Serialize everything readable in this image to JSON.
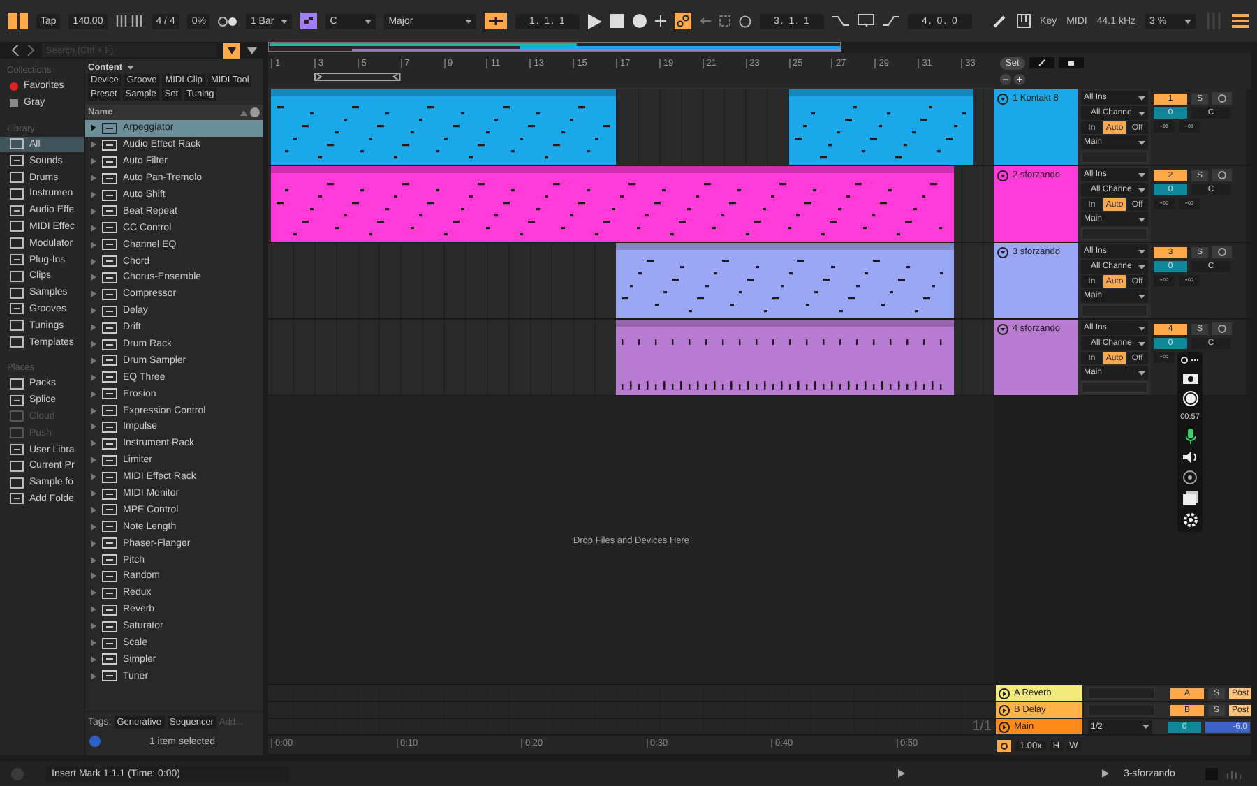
{
  "transport": {
    "tap": "Tap",
    "tempo": "140.00",
    "signature": "4 / 4",
    "swing": "0%",
    "quantize": "1 Bar",
    "key": "C",
    "scale": "Major",
    "position": "1. 1. 1",
    "loop_start": "3. 1. 1",
    "loop_length": "4. 0. 0",
    "key_map": "Key",
    "midi_map": "MIDI",
    "sample_rate": "44.1 kHz",
    "cpu": "3 %"
  },
  "search": {
    "placeholder": "Search (Ctrl + F)"
  },
  "sidebar": {
    "sections": [
      {
        "title": "Collections",
        "items": [
          {
            "label": "Favorites",
            "selected": false,
            "disabled": false,
            "color": "#e02424"
          },
          {
            "label": "Gray",
            "selected": false,
            "disabled": false,
            "color": "#8a8a8a"
          }
        ]
      },
      {
        "title": "Library",
        "items": [
          {
            "label": "All",
            "selected": true,
            "disabled": false
          },
          {
            "label": "Sounds",
            "selected": false,
            "disabled": false
          },
          {
            "label": "Drums",
            "selected": false,
            "disabled": false
          },
          {
            "label": "Instrumen",
            "selected": false,
            "disabled": false
          },
          {
            "label": "Audio Effe",
            "selected": false,
            "disabled": false
          },
          {
            "label": "MIDI Effec",
            "selected": false,
            "disabled": false
          },
          {
            "label": "Modulator",
            "selected": false,
            "disabled": false
          },
          {
            "label": "Plug-Ins",
            "selected": false,
            "disabled": false
          },
          {
            "label": "Clips",
            "selected": false,
            "disabled": false
          },
          {
            "label": "Samples",
            "selected": false,
            "disabled": false
          },
          {
            "label": "Grooves",
            "selected": false,
            "disabled": false
          },
          {
            "label": "Tunings",
            "selected": false,
            "disabled": false
          },
          {
            "label": "Templates",
            "selected": false,
            "disabled": false
          }
        ]
      },
      {
        "title": "Places",
        "items": [
          {
            "label": "Packs",
            "selected": false,
            "disabled": false
          },
          {
            "label": "Splice",
            "selected": false,
            "disabled": false
          },
          {
            "label": "Cloud",
            "selected": false,
            "disabled": true
          },
          {
            "label": "Push",
            "selected": false,
            "disabled": true
          },
          {
            "label": "User Libra",
            "selected": false,
            "disabled": false
          },
          {
            "label": "Current Pr",
            "selected": false,
            "disabled": false
          },
          {
            "label": "Sample fo",
            "selected": false,
            "disabled": false
          },
          {
            "label": "Add Folde",
            "selected": false,
            "disabled": false
          }
        ]
      }
    ]
  },
  "browser": {
    "content_label": "Content",
    "filters": [
      "Device",
      "Groove",
      "MIDI Clip",
      "MIDI Tool",
      "Preset",
      "Sample",
      "Set",
      "Tuning"
    ],
    "column": "Name",
    "items": [
      {
        "label": "Arpeggiator",
        "selected": true
      },
      {
        "label": "Audio Effect Rack",
        "selected": false
      },
      {
        "label": "Auto Filter",
        "selected": false
      },
      {
        "label": "Auto Pan-Tremolo",
        "selected": false
      },
      {
        "label": "Auto Shift",
        "selected": false
      },
      {
        "label": "Beat Repeat",
        "selected": false
      },
      {
        "label": "CC Control",
        "selected": false
      },
      {
        "label": "Channel EQ",
        "selected": false
      },
      {
        "label": "Chord",
        "selected": false
      },
      {
        "label": "Chorus-Ensemble",
        "selected": false
      },
      {
        "label": "Compressor",
        "selected": false
      },
      {
        "label": "Delay",
        "selected": false
      },
      {
        "label": "Drift",
        "selected": false
      },
      {
        "label": "Drum Rack",
        "selected": false
      },
      {
        "label": "Drum Sampler",
        "selected": false
      },
      {
        "label": "EQ Three",
        "selected": false
      },
      {
        "label": "Erosion",
        "selected": false
      },
      {
        "label": "Expression Control",
        "selected": false
      },
      {
        "label": "Impulse",
        "selected": false
      },
      {
        "label": "Instrument Rack",
        "selected": false
      },
      {
        "label": "Limiter",
        "selected": false
      },
      {
        "label": "MIDI Effect Rack",
        "selected": false
      },
      {
        "label": "MIDI Monitor",
        "selected": false
      },
      {
        "label": "MPE Control",
        "selected": false
      },
      {
        "label": "Note Length",
        "selected": false
      },
      {
        "label": "Phaser-Flanger",
        "selected": false
      },
      {
        "label": "Pitch",
        "selected": false
      },
      {
        "label": "Random",
        "selected": false
      },
      {
        "label": "Redux",
        "selected": false
      },
      {
        "label": "Reverb",
        "selected": false
      },
      {
        "label": "Saturator",
        "selected": false
      },
      {
        "label": "Scale",
        "selected": false
      },
      {
        "label": "Simpler",
        "selected": false
      },
      {
        "label": "Tuner",
        "selected": false
      }
    ],
    "tags_label": "Tags:",
    "tags": [
      "Generative",
      "Sequencer"
    ],
    "tag_placeholder": "Add...",
    "status": "1 item selected"
  },
  "arrangement": {
    "bars": [
      "1",
      "3",
      "5",
      "7",
      "9",
      "11",
      "13",
      "15",
      "17",
      "19",
      "21",
      "23",
      "25",
      "27",
      "29",
      "31",
      "33"
    ],
    "set_button": "Set",
    "drop_hint": "Drop Files and Devices Here",
    "times": [
      "0:00",
      "0:10",
      "0:20",
      "0:30",
      "0:40",
      "0:50"
    ],
    "fraction": "1/1",
    "zoom": "1.00x",
    "h_button": "H",
    "w_button": "W"
  },
  "tracks": [
    {
      "name": "1 Kontakt 8",
      "color": "#1aa8e8",
      "input": "All Ins",
      "channel": "All Channe",
      "monitor": [
        {
          "label": "In",
          "selected": false
        },
        {
          "label": "Auto",
          "selected": true
        },
        {
          "label": "Off",
          "selected": false
        }
      ],
      "output": "Main",
      "number": "1",
      "solo": "S",
      "volume": "0",
      "pan": "C",
      "meter_left": "-∞",
      "meter_right": "-∞"
    },
    {
      "name": "2 sforzando",
      "color": "#ff3ad6",
      "input": "All Ins",
      "channel": "All Channe",
      "monitor": [
        {
          "label": "In",
          "selected": false
        },
        {
          "label": "Auto",
          "selected": true
        },
        {
          "label": "Off",
          "selected": false
        }
      ],
      "output": "Main",
      "number": "2",
      "solo": "S",
      "volume": "0",
      "pan": "C",
      "meter_left": "-∞",
      "meter_right": "-∞"
    },
    {
      "name": "3 sforzando",
      "color": "#9aa6f6",
      "input": "All Ins",
      "channel": "All Channe",
      "monitor": [
        {
          "label": "In",
          "selected": false
        },
        {
          "label": "Auto",
          "selected": true
        },
        {
          "label": "Off",
          "selected": false
        }
      ],
      "output": "Main",
      "number": "3",
      "solo": "S",
      "volume": "0",
      "pan": "C",
      "meter_left": "-∞",
      "meter_right": "-∞"
    },
    {
      "name": "4 sforzando",
      "color": "#b77cd2",
      "input": "All Ins",
      "channel": "All Channe",
      "monitor": [
        {
          "label": "In",
          "selected": false
        },
        {
          "label": "Auto",
          "selected": true
        },
        {
          "label": "Off",
          "selected": false
        }
      ],
      "output": "Main",
      "number": "4",
      "solo": "S",
      "volume": "0",
      "pan": "C",
      "meter_left": "-∞"
    }
  ],
  "returns": [
    {
      "kind": "return",
      "name": "A Reverb",
      "color": "#f2ea7c",
      "letter": "A",
      "solo": "S",
      "post": "Post"
    },
    {
      "kind": "return",
      "name": "B Delay",
      "color": "#ffb347",
      "letter": "B",
      "solo": "S",
      "post": "Post"
    },
    {
      "kind": "main",
      "name": "Main",
      "color": "#ff8a1c",
      "output": "1/2",
      "volume": "0",
      "gain": "-6.0"
    }
  ],
  "recorder": {
    "timer": "00:57"
  },
  "status_bar": {
    "message": "Insert Mark 1.1.1 (Time: 0:00)",
    "track": "3-sforzando"
  }
}
